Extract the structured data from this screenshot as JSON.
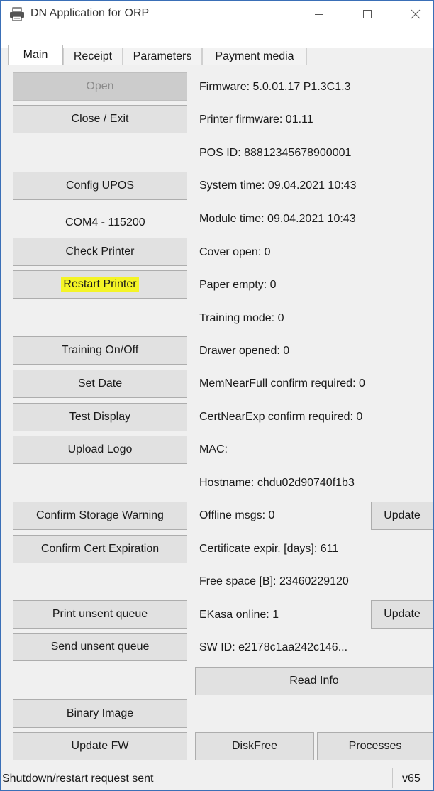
{
  "window": {
    "title": "DN Application for ORP",
    "icon": "printer-icon",
    "controls": [
      "minimize-icon",
      "maximize-icon",
      "close-icon"
    ]
  },
  "tabs": [
    {
      "label": "Main",
      "active": true
    },
    {
      "label": "Receipt",
      "active": false
    },
    {
      "label": "Parameters",
      "active": false
    },
    {
      "label": "Payment media",
      "active": false
    }
  ],
  "left": {
    "open": "Open",
    "close_exit": "Close / Exit",
    "config_upos": "Config UPOS",
    "port_info": "COM4 - 115200",
    "check_printer": "Check Printer",
    "restart_printer": "Restart Printer",
    "training_onoff": "Training On/Off",
    "set_date": "Set Date",
    "test_display": "Test Display",
    "upload_logo": "Upload Logo",
    "confirm_storage_warning": "Confirm Storage Warning",
    "confirm_cert_expiration": "Confirm Cert Expiration",
    "print_unsent_queue": "Print unsent queue",
    "send_unsent_queue": "Send unsent queue",
    "binary_image": "Binary Image",
    "update_fw": "Update FW"
  },
  "info": {
    "firmware": "Firmware: 5.0.01.17 P1.3C1.3",
    "printer_firmware": "Printer firmware: 01.11",
    "pos_id": "POS ID: 88812345678900001",
    "system_time": "System time: 09.04.2021 10:43",
    "module_time": "Module time: 09.04.2021 10:43",
    "cover_open": "Cover open: 0",
    "paper_empty": "Paper empty: 0",
    "training_mode": "Training mode: 0",
    "drawer_opened": "Drawer opened: 0",
    "memnearfull": "MemNearFull confirm required: 0",
    "certnearexp": "CertNearExp confirm required: 0",
    "mac": "MAC:",
    "hostname": "Hostname: chdu02d90740f1b3",
    "offline_msgs": "Offline msgs: 0",
    "cert_expir": "Certificate expir. [days]: 611",
    "free_space": "Free space [B]: 23460229120",
    "ekasa_online": "EKasa online: 1",
    "sw_id": "SW ID: e2178c1aa242c146..."
  },
  "right_buttons": {
    "update": "Update",
    "read_info": "Read Info",
    "diskfree": "DiskFree",
    "processes": "Processes"
  },
  "status": {
    "message": "Shutdown/restart request sent",
    "version": "v65"
  },
  "colors": {
    "highlight": "#f4f426",
    "window_border": "#3a6fb7"
  }
}
